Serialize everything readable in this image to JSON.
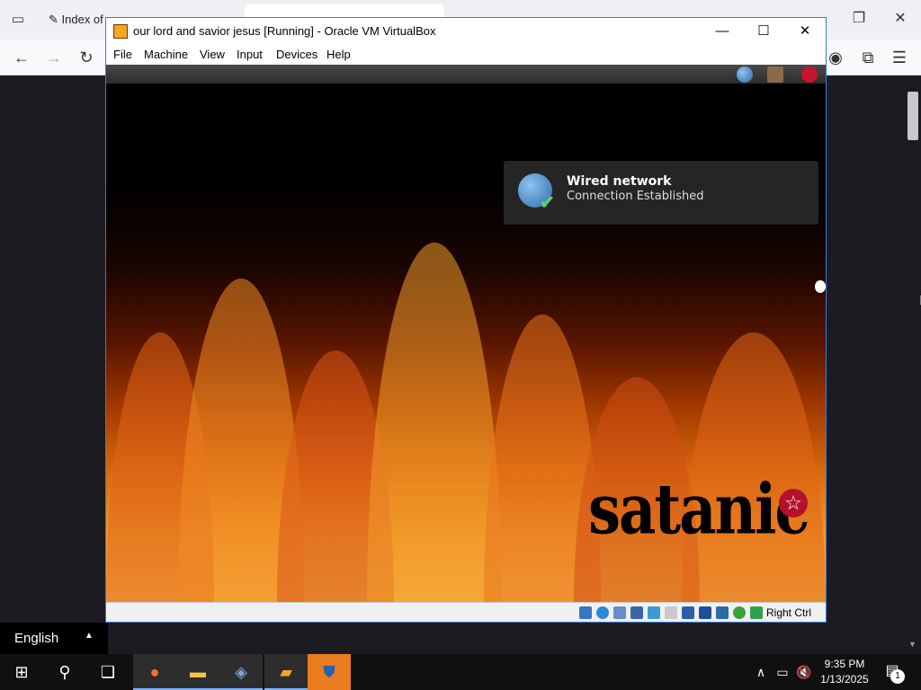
{
  "browser": {
    "tabs": [
      {
        "label": "Index of ..."
      },
      {
        "label": ""
      }
    ],
    "tab_list_icon": "tab-list-icon",
    "nav": {
      "back": "back-icon",
      "forward": "forward-icon",
      "reload": "reload-icon"
    },
    "toolbar_icons": [
      "account-icon",
      "extensions-icon",
      "menu-icon"
    ]
  },
  "vbox": {
    "title": "our lord and savior jesus [Running] - Oracle VM VirtualBox",
    "menu": [
      "File",
      "Machine",
      "View",
      "Input",
      "Devices",
      "Help"
    ],
    "host_key": "Right Ctrl"
  },
  "guest": {
    "notification": {
      "title": "Wired network",
      "body": "Connection Established"
    },
    "logo_text": "satanic"
  },
  "langbar": {
    "label": "English"
  },
  "taskbar": {
    "time": "9:35 PM",
    "date": "1/13/2025",
    "notification_count": "1"
  },
  "colors": {
    "taskbar": "#101010",
    "vbox_border": "#3a7bd5",
    "notification_bg": "#282828",
    "pentagram": "#b3122a"
  }
}
